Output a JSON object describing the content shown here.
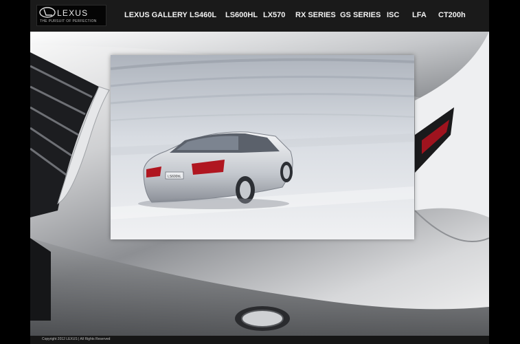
{
  "brand": {
    "name": "LEXUS",
    "tagline": "THE PURSUIT OF PERFECTION"
  },
  "nav": {
    "items": [
      {
        "label": "LEXUS GALLERY"
      },
      {
        "label": "LS460L"
      },
      {
        "label": "LS600HL"
      },
      {
        "label": "LX570"
      },
      {
        "label": "RX SERIES"
      },
      {
        "label": "GS SERIES"
      },
      {
        "label": "ISC"
      },
      {
        "label": "LFA"
      },
      {
        "label": "CT200h"
      }
    ]
  },
  "gallery": {
    "license_plate": "LS600hL"
  },
  "footer": {
    "copyright": "Copyright 2012 LEXUS | All Rights Reserved"
  },
  "colors": {
    "page_background": "#000000",
    "topbar": "#1a1a1a",
    "nav_text": "#f2f2f2",
    "tail_light": "#c1121f"
  }
}
